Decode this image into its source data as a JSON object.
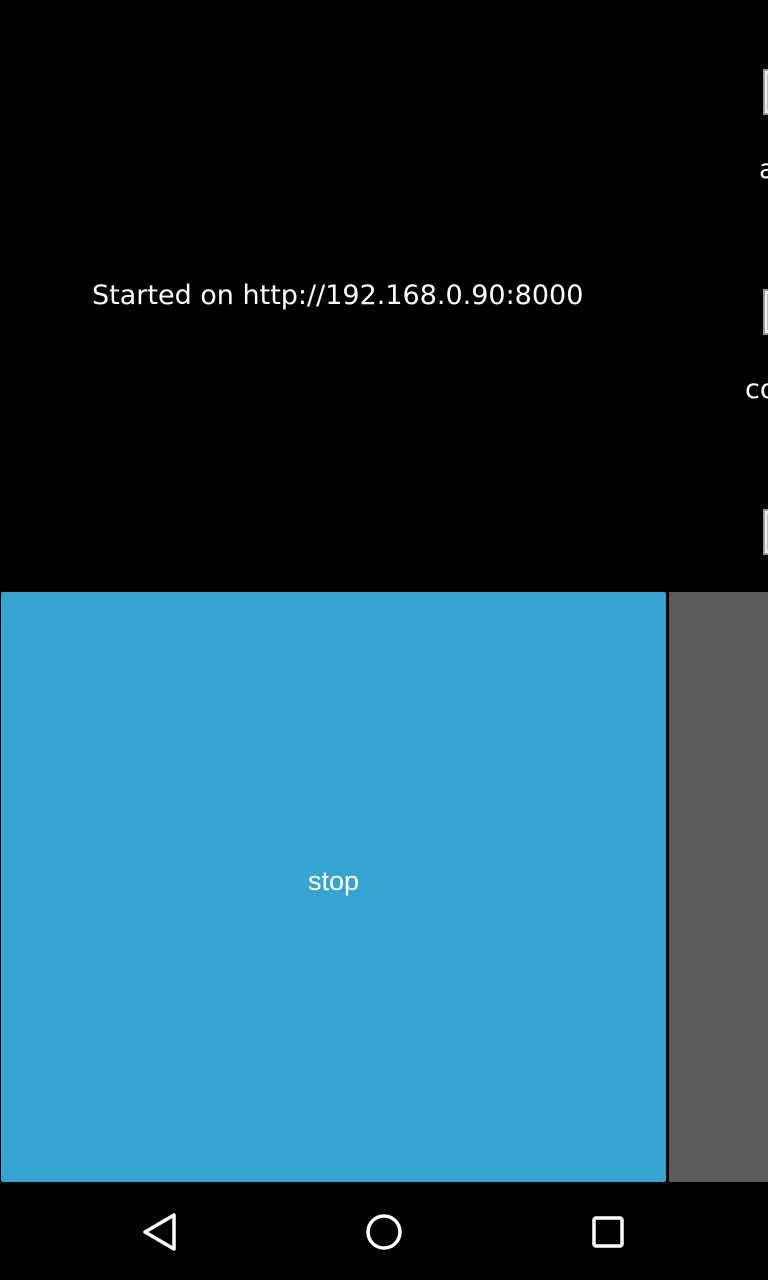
{
  "status": {
    "text": "Started on http://192.168.0.90:8000"
  },
  "side_files": [
    {
      "icon": "document-icon",
      "label": "a"
    },
    {
      "icon": "document-icon",
      "label": "co"
    },
    {
      "icon": "document-icon",
      "label": ""
    }
  ],
  "stop_button": {
    "label": "stop",
    "color": "#35a4d1"
  },
  "side_panel": {
    "color": "#5b5b5b"
  },
  "nav_bar": {
    "back_icon": "back-triangle-icon",
    "home_icon": "home-circle-icon",
    "recents_icon": "recents-square-icon"
  }
}
